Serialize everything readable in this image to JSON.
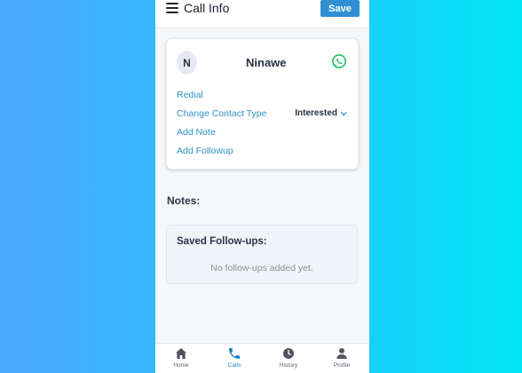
{
  "header": {
    "title": "Call Info",
    "save_label": "Save"
  },
  "contact": {
    "initial": "N",
    "name": "Ninawe",
    "actions": [
      "Redial",
      "Change Contact Type",
      "Add Note",
      "Add Followup"
    ],
    "contact_type": "Interested"
  },
  "notes": {
    "label": "Notes:"
  },
  "followups": {
    "title": "Saved Follow-ups:",
    "empty": "No follow-ups added yet."
  },
  "nav": [
    {
      "label": "Home",
      "icon": "home-icon",
      "active": false
    },
    {
      "label": "Calls",
      "icon": "phone-icon",
      "active": true
    },
    {
      "label": "History",
      "icon": "clock-icon",
      "active": false
    },
    {
      "label": "Profile",
      "icon": "user-icon",
      "active": false
    }
  ],
  "colors": {
    "accent": "#2f8fd0",
    "link": "#2f92c5",
    "whatsapp": "#25c26a",
    "active_nav": "#1a7ec4"
  }
}
